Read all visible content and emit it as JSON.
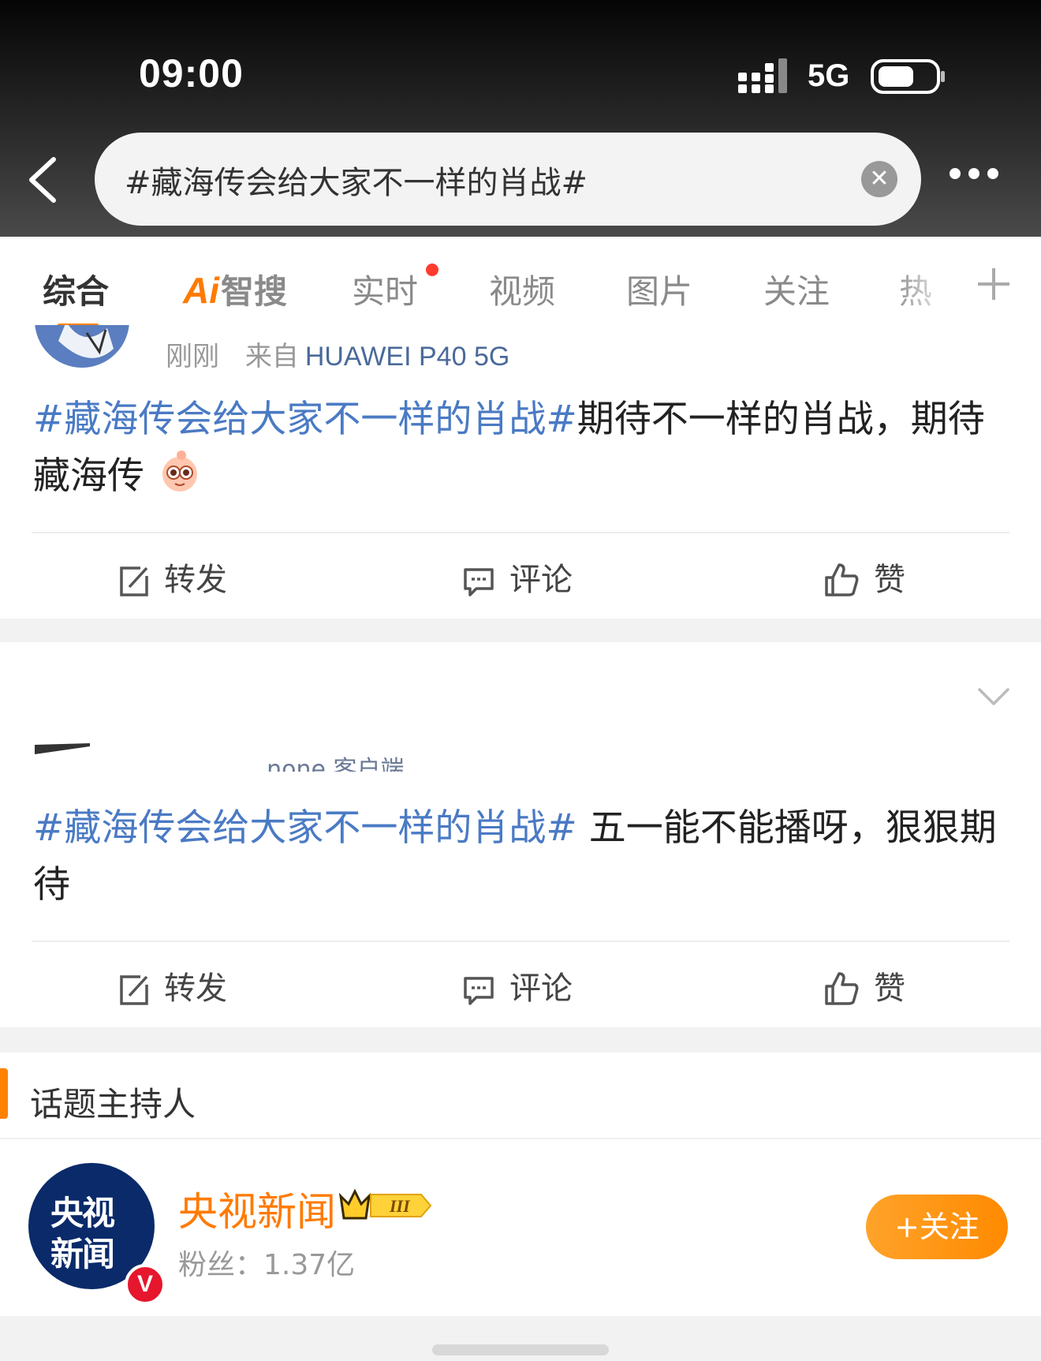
{
  "status_bar": {
    "time": "09:00",
    "network": "5G"
  },
  "search": {
    "query": "#藏海传会给大家不一样的肖战#"
  },
  "tabs": [
    {
      "label": "综合"
    },
    {
      "label_ai": "Ai",
      "label": "智搜"
    },
    {
      "label": "实时"
    },
    {
      "label": "视频"
    },
    {
      "label": "图片"
    },
    {
      "label": "关注"
    },
    {
      "label": "热"
    }
  ],
  "posts": [
    {
      "time": "刚刚",
      "source_prefix": "来自",
      "source": "HUAWEI P40 5G",
      "topic": "#藏海传会给大家不一样的肖战#",
      "text": "期待不一样的肖战，期待藏海传",
      "emoji": "happy-emoji"
    },
    {
      "source_fragment": "... none 客户端",
      "topic": "#藏海传会给大家不一样的肖战#",
      "text": " 五一能不能播呀，狠狠期待"
    }
  ],
  "actions": {
    "repost": "转发",
    "comment": "评论",
    "like": "赞"
  },
  "topic_host": {
    "title": "话题主持人",
    "name": "央视新闻",
    "avatar_line1": "央视",
    "avatar_line2": "新闻",
    "verified_mark": "V",
    "fans_label": "粉丝：",
    "fans_count": "1.37亿",
    "follow_label": "+关注",
    "level": "III"
  },
  "colors": {
    "accent": "#ff8200",
    "topic_link": "#4a7ac4",
    "follow_button": "#ff8a00",
    "verified": "#e6162d",
    "unread_dot": "#ff3b30"
  }
}
